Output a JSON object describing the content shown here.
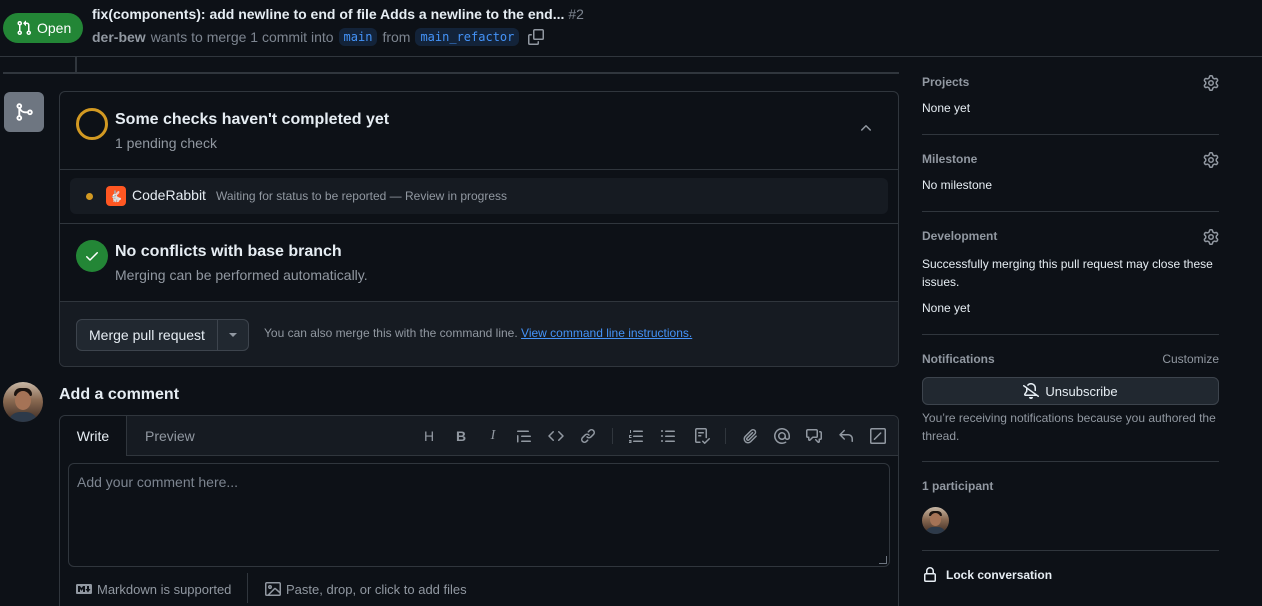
{
  "header": {
    "state": "Open",
    "title": "fix(components): add newline to end of file Adds a newline to the end...",
    "number": "#2",
    "author": "der-bew",
    "merge_text": "wants to merge 1 commit into",
    "base_branch": "main",
    "from_text": "from",
    "head_branch": "main_refactor"
  },
  "checks": {
    "title": "Some checks haven't completed yet",
    "subtitle": "1 pending check",
    "items": [
      {
        "name": "CodeRabbit",
        "status": "Waiting for status to be reported — Review in progress"
      }
    ]
  },
  "conflicts": {
    "title": "No conflicts with base branch",
    "subtitle": "Merging can be performed automatically."
  },
  "merge": {
    "button_label": "Merge pull request",
    "cmd_text": "You can also merge this with the command line.",
    "cmd_link": "View command line instructions."
  },
  "comment": {
    "title": "Add a comment",
    "tab_write": "Write",
    "tab_preview": "Preview",
    "placeholder": "Add your comment here...",
    "markdown_note": "Markdown is supported",
    "files_note": "Paste, drop, or click to add files",
    "toolbar": [
      "heading-icon",
      "bold-icon",
      "italic-icon",
      "quote-icon",
      "code-icon",
      "link-icon",
      "numbered-list-icon",
      "bulleted-list-icon",
      "task-list-icon",
      "attach-icon",
      "mention-icon",
      "reference-icon",
      "undo-icon",
      "slash-commands-icon"
    ]
  },
  "sidebar": {
    "projects": {
      "heading": "Projects",
      "value": "None yet"
    },
    "milestone": {
      "heading": "Milestone",
      "value": "No milestone"
    },
    "development": {
      "heading": "Development",
      "note": "Successfully merging this pull request may close these issues.",
      "value": "None yet"
    },
    "notifications": {
      "heading": "Notifications",
      "customize": "Customize",
      "button": "Unsubscribe",
      "note": "You’re receiving notifications because you authored the thread."
    },
    "participants": {
      "heading": "1 participant"
    },
    "lock": "Lock conversation"
  },
  "colors": {
    "open_green": "#238636",
    "pending": "#d29922",
    "link": "#4493f8",
    "background": "#0d1117"
  }
}
